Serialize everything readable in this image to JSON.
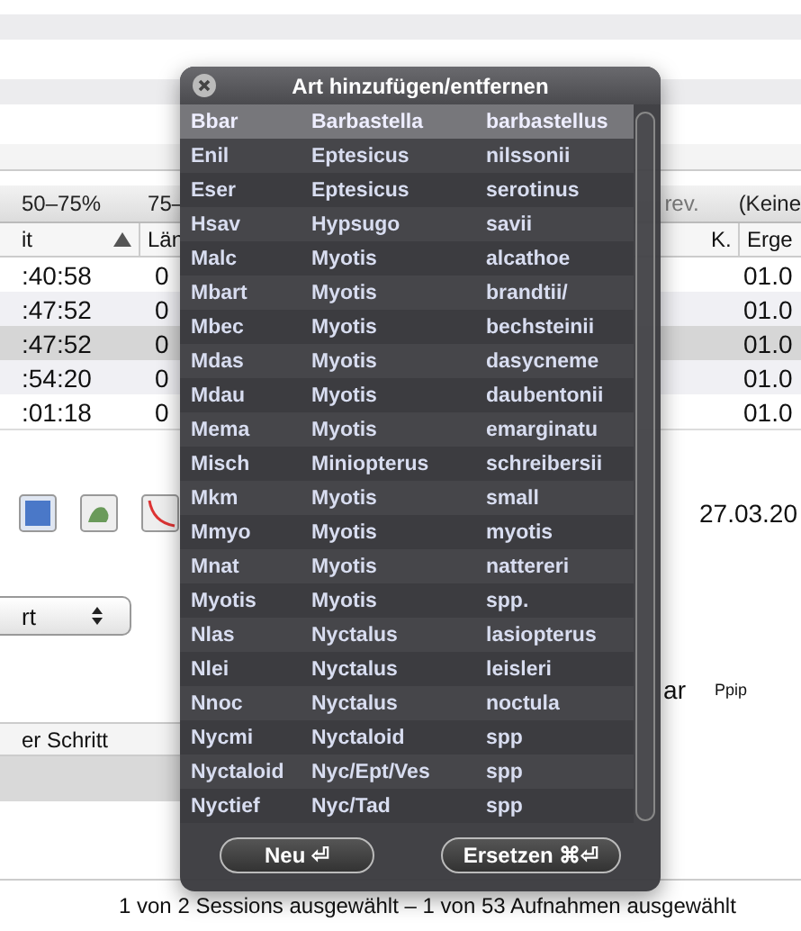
{
  "filter_bar": {
    "ranges": [
      "50–75%",
      "75–"
    ],
    "right": [
      "rev.",
      "(Keine"
    ]
  },
  "table": {
    "left_columns": [
      "it",
      "Län"
    ],
    "right_columns": [
      "K.",
      "Erge"
    ],
    "rows": [
      {
        "time": ":40:58",
        "length": "0",
        "result": "01.0",
        "selected": false
      },
      {
        "time": ":47:52",
        "length": "0",
        "result": "01.0",
        "selected": false
      },
      {
        "time": ":47:52",
        "length": "0",
        "result": "01.0",
        "selected": true
      },
      {
        "time": ":54:20",
        "length": "0",
        "result": "01.0",
        "selected": false
      },
      {
        "time": ":01:18",
        "length": "0",
        "result": "01.0",
        "selected": false
      }
    ]
  },
  "date": "27.03.20",
  "comment_label": "ar",
  "comment_value": "Ppip",
  "popup": "rt",
  "steps_header": "er Schritt",
  "status_bar": "1 von 2 Sessions ausgewählt – 1 von 53 Aufnahmen ausgewählt",
  "panel": {
    "title": "Art hinzufügen/entfernen",
    "species": [
      {
        "code": "Bbar",
        "genus": "Barbastella",
        "species": "barbastellus",
        "selected": true
      },
      {
        "code": "Enil",
        "genus": "Eptesicus",
        "species": "nilssonii",
        "selected": false
      },
      {
        "code": "Eser",
        "genus": "Eptesicus",
        "species": "serotinus",
        "selected": false
      },
      {
        "code": "Hsav",
        "genus": "Hypsugo",
        "species": "savii",
        "selected": false
      },
      {
        "code": "Malc",
        "genus": "Myotis",
        "species": "alcathoe",
        "selected": false
      },
      {
        "code": "Mbart",
        "genus": "Myotis",
        "species": "brandtii/",
        "selected": false
      },
      {
        "code": "Mbec",
        "genus": "Myotis",
        "species": "bechsteinii",
        "selected": false
      },
      {
        "code": "Mdas",
        "genus": "Myotis",
        "species": "dasycneme",
        "selected": false
      },
      {
        "code": "Mdau",
        "genus": "Myotis",
        "species": "daubentonii",
        "selected": false
      },
      {
        "code": "Mema",
        "genus": "Myotis",
        "species": "emarginatu",
        "selected": false
      },
      {
        "code": "Misch",
        "genus": "Miniopterus",
        "species": "schreibersii",
        "selected": false
      },
      {
        "code": "Mkm",
        "genus": "Myotis",
        "species": "small",
        "selected": false
      },
      {
        "code": "Mmyo",
        "genus": "Myotis",
        "species": "myotis",
        "selected": false
      },
      {
        "code": "Mnat",
        "genus": "Myotis",
        "species": "nattereri",
        "selected": false
      },
      {
        "code": "Myotis",
        "genus": "Myotis",
        "species": "spp.",
        "selected": false
      },
      {
        "code": "Nlas",
        "genus": "Nyctalus",
        "species": "lasiopterus",
        "selected": false
      },
      {
        "code": "Nlei",
        "genus": "Nyctalus",
        "species": "leisleri",
        "selected": false
      },
      {
        "code": "Nnoc",
        "genus": "Nyctalus",
        "species": "noctula",
        "selected": false
      },
      {
        "code": "Nycmi",
        "genus": "Nyctaloid",
        "species": "spp",
        "selected": false
      },
      {
        "code": "Nyctaloid",
        "genus": "Nyc/Ept/Ves",
        "species": "spp",
        "selected": false
      },
      {
        "code": "Nyctief",
        "genus": "Nyc/Tad",
        "species": "spp",
        "selected": false
      }
    ],
    "buttons": [
      "Neu ⏎",
      "Ersetzen ⌘⏎"
    ]
  }
}
